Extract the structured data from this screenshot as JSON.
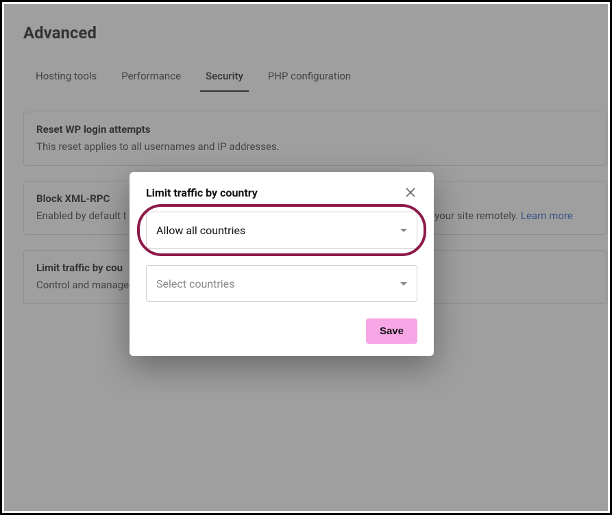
{
  "page": {
    "title": "Advanced"
  },
  "tabs": {
    "items": [
      {
        "label": "Hosting tools"
      },
      {
        "label": "Performance"
      },
      {
        "label": "Security"
      },
      {
        "label": "PHP configuration"
      }
    ]
  },
  "cards": {
    "reset": {
      "title": "Reset WP login attempts",
      "desc": "This reset applies to all usernames and IP addresses."
    },
    "xmlrpc": {
      "title": "Block XML-RPC",
      "desc_pre": "Enabled by default t",
      "desc_post": "g your site remotely. ",
      "learn_more": "Learn more"
    },
    "limit": {
      "title": "Limit traffic by cou",
      "desc": "Control and manage"
    }
  },
  "modal": {
    "title": "Limit traffic by country",
    "select_primary": "Allow all countries",
    "select_secondary_placeholder": "Select countries",
    "save": "Save"
  }
}
